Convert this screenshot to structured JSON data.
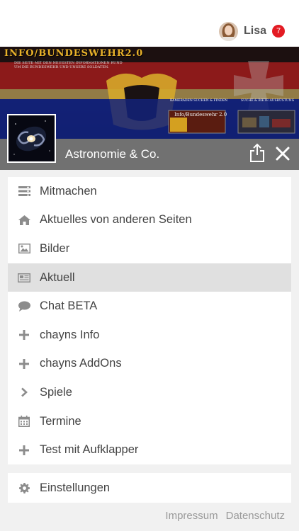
{
  "user": {
    "name": "Lisa",
    "notification_count": "7"
  },
  "banner": {
    "title": "INFO/BUNDESWEHR2.0",
    "subtitle_line1": "DIE SEITE MIT DEN NEUESTEN INFORMATIONEN RUND",
    "subtitle_line2": "UM DIE BUNDESWEHR UND UNSERE SOLDATEN.",
    "link_left": "KAMERADEN SUCHEN & FINDEN",
    "link_right": "SUCHE & BIETE AUSRÜSTUNG",
    "thumb_text": "Info/Bundeswehr 2.0"
  },
  "site": {
    "title": "Astronomie & Co."
  },
  "menu": {
    "items": [
      {
        "label": "Mitmachen",
        "icon": "list-icon"
      },
      {
        "label": "Aktuelles von anderen Seiten",
        "icon": "home-icon"
      },
      {
        "label": "Bilder",
        "icon": "image-icon"
      },
      {
        "label": "Aktuell",
        "icon": "newspaper-icon",
        "active": true
      },
      {
        "label": "Chat BETA",
        "icon": "chat-icon"
      },
      {
        "label": "chayns Info",
        "icon": "plus-icon"
      },
      {
        "label": "chayns AddOns",
        "icon": "plus-icon"
      },
      {
        "label": "Spiele",
        "icon": "chevron-right-icon"
      },
      {
        "label": "Termine",
        "icon": "calendar-icon"
      },
      {
        "label": "Test mit Aufklapper",
        "icon": "plus-icon"
      }
    ]
  },
  "settings": {
    "label": "Einstellungen",
    "icon": "gear-icon"
  },
  "footer": {
    "impressum": "Impressum",
    "datenschutz": "Datenschutz"
  },
  "colors": {
    "badge": "#e31b23",
    "header_bar": "#717171",
    "active_item": "#e0e0e0",
    "icon_gray": "#8c8c8c"
  }
}
